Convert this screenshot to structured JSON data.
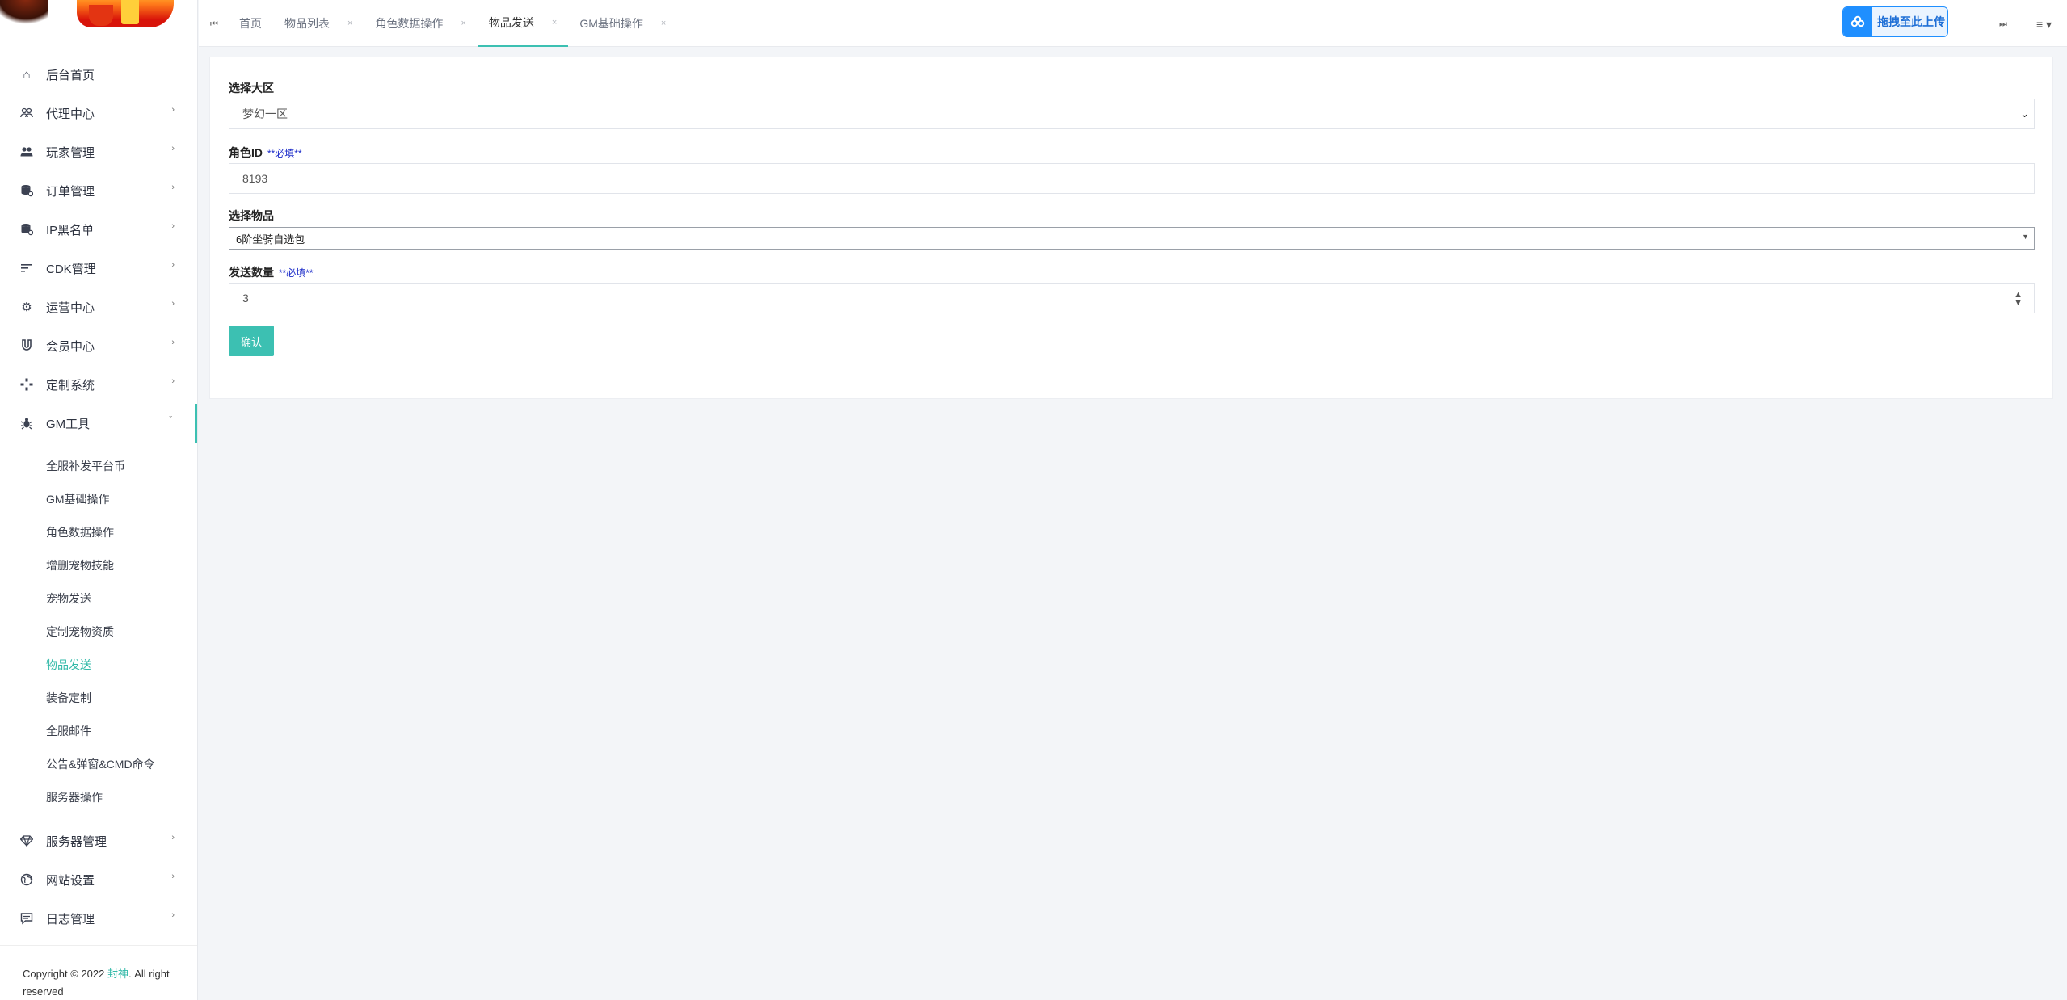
{
  "sidebar": {
    "items": [
      {
        "label": "后台首页",
        "icon": "home-icon",
        "has_arrow": false
      },
      {
        "label": "代理中心",
        "icon": "agents-icon",
        "has_arrow": true
      },
      {
        "label": "玩家管理",
        "icon": "players-icon",
        "has_arrow": true
      },
      {
        "label": "订单管理",
        "icon": "database-icon",
        "has_arrow": true
      },
      {
        "label": "IP黑名单",
        "icon": "database-icon",
        "has_arrow": true
      },
      {
        "label": "CDK管理",
        "icon": "sort-icon",
        "has_arrow": true
      },
      {
        "label": "运营中心",
        "icon": "gear-icon",
        "has_arrow": true
      },
      {
        "label": "会员中心",
        "icon": "magnet-icon",
        "has_arrow": true
      },
      {
        "label": "定制系统",
        "icon": "gamepad-icon",
        "has_arrow": true
      },
      {
        "label": "GM工具",
        "icon": "bug-icon",
        "has_arrow": true,
        "expanded": true
      }
    ],
    "gm_sub": [
      "全服补发平台币",
      "GM基础操作",
      "角色数据操作",
      "增删宠物技能",
      "宠物发送",
      "定制宠物资质",
      "物品发送",
      "装备定制",
      "全服邮件",
      "公告&弹窗&CMD命令",
      "服务器操作"
    ],
    "gm_sub_active": "物品发送",
    "bottom_items": [
      {
        "label": "服务器管理",
        "icon": "diamond-icon"
      },
      {
        "label": "网站设置",
        "icon": "globe-icon"
      },
      {
        "label": "日志管理",
        "icon": "message-icon"
      }
    ],
    "copyright_prefix": "Copyright © 2022",
    "copyright_name": "封神",
    "copyright_suffix": ". All right reserved"
  },
  "topbar": {
    "tabs": [
      {
        "label": "首页",
        "closable": false
      },
      {
        "label": "物品列表",
        "closable": true
      },
      {
        "label": "角色数据操作",
        "closable": true
      },
      {
        "label": "物品发送",
        "closable": true,
        "active": true
      },
      {
        "label": "GM基础操作",
        "closable": true
      }
    ],
    "close_glyph": "×",
    "upload_label": "拖拽至此上传",
    "accent": "#3cc0b2"
  },
  "form": {
    "region_label": "选择大区",
    "region_value": "梦幻一区",
    "role_label": "角色ID",
    "required_mark": "**必填**",
    "role_value": "8193",
    "item_label": "选择物品",
    "item_value": "6阶坐骑自选包",
    "qty_label": "发送数量",
    "qty_value": "3",
    "confirm_label": "确认"
  }
}
